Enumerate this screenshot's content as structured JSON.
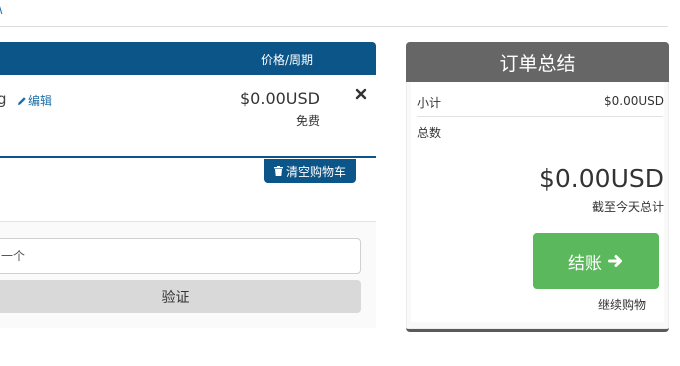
{
  "top": {
    "link_text": "\\"
  },
  "cart": {
    "header": {
      "price_cycle": "价格/周期"
    },
    "item": {
      "name_tail": "g",
      "edit_label": "编辑",
      "price": "$0.00USD",
      "cycle": "免费"
    },
    "empty_cart_label": "清空购物车"
  },
  "promo": {
    "input_value": "一个",
    "validate_label": "验证"
  },
  "summary": {
    "title": "订单总结",
    "subtotal_label": "小计",
    "subtotal_value": "$0.00USD",
    "total_label": "总数",
    "total_amount": "$0.00USD",
    "total_note": "截至今天总计",
    "checkout_label": "结账",
    "continue_label": "继续购物"
  },
  "colors": {
    "primary": "#0c5588",
    "summary_header": "#666666",
    "checkout": "#5cb85c",
    "link": "#1e6fa8"
  },
  "icons": {
    "edit": "pencil-icon",
    "remove": "close-icon",
    "empty_cart": "trash-icon",
    "checkout": "arrow-right-icon"
  }
}
